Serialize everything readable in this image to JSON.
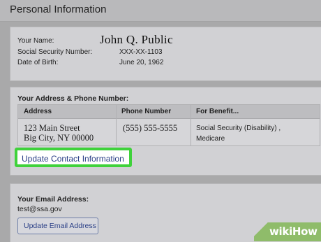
{
  "header": {
    "title": "Personal Information"
  },
  "personal": {
    "name_label": "Your Name:",
    "name_value": "John Q. Public",
    "ssn_label": "Social Security Number:",
    "ssn_value": "XXX-XX-1103",
    "dob_label": "Date of Birth:",
    "dob_value": "June 20, 1962"
  },
  "address": {
    "section_title": "Your Address & Phone Number:",
    "columns": [
      "Address",
      "Phone Number",
      "For Benefit..."
    ],
    "row": {
      "address_line1": "123 Main Street",
      "address_line2": "Big City,  NY 00000",
      "phone": "(555) 555-5555",
      "benefit_line1": "Social Security (Disability) ,",
      "benefit_line2": "Medicare"
    },
    "update_button": "Update Contact Information"
  },
  "email": {
    "section_title": "Your Email Address:",
    "value": "test@ssa.gov",
    "update_button": "Update Email Address"
  },
  "watermark": {
    "text": "wikiHow"
  },
  "colors": {
    "highlight": "#3fd23b",
    "link": "#2a3f86",
    "watermark": "#8fbc6a"
  }
}
